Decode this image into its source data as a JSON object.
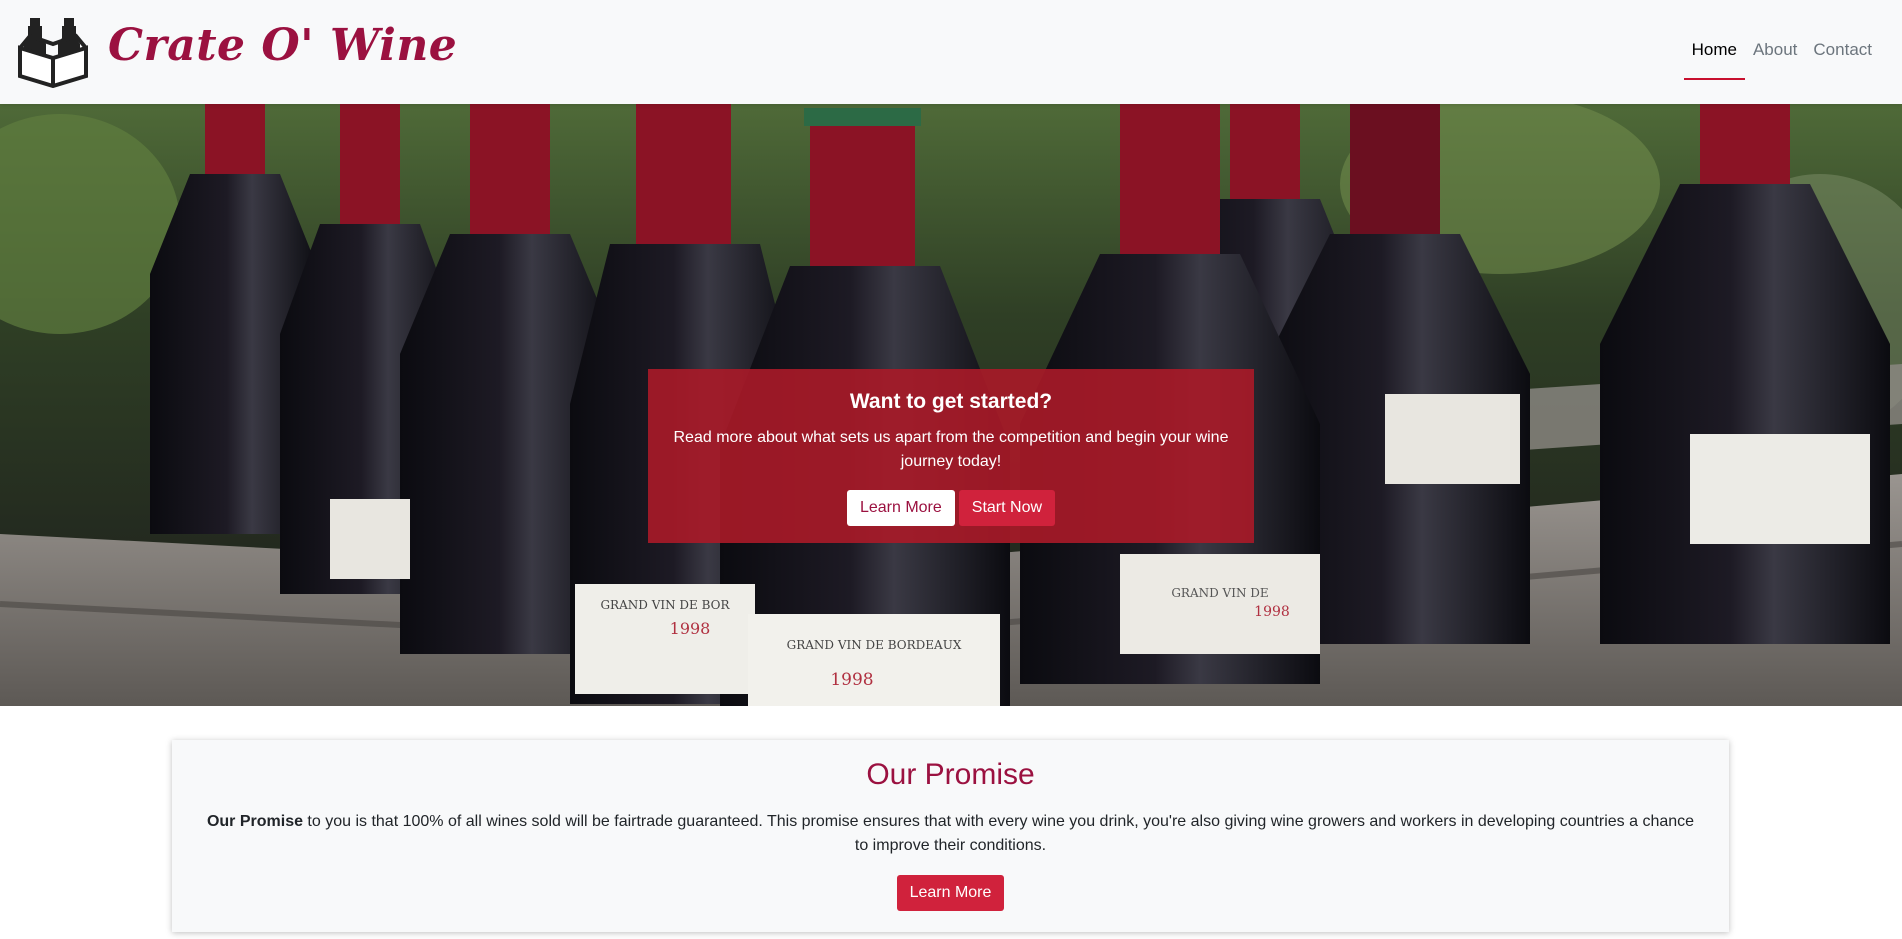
{
  "brand": {
    "name": "Crate O' Wine",
    "logo_icon": "wine-crate-icon",
    "color": "#9b1140"
  },
  "nav": {
    "items": [
      {
        "label": "Home",
        "active": true
      },
      {
        "label": "About",
        "active": false
      },
      {
        "label": "Contact",
        "active": false
      }
    ]
  },
  "hero": {
    "image": "wine-bottles-in-crate",
    "bottle_labels": [
      {
        "text": "GRAND VIN DE BORDEAUX",
        "year": "1998"
      },
      {
        "text": "GRAND VIN DE BOR",
        "year": "1998"
      },
      {
        "text": "GRAND VIN DE",
        "year": "1998"
      }
    ],
    "cta": {
      "heading": "Want to get started?",
      "body": "Read more about what sets us apart from the competition and begin your wine journey today!",
      "learn_more": "Learn More",
      "start_now": "Start Now"
    }
  },
  "promise": {
    "heading": "Our Promise",
    "lead_bold": "Our Promise",
    "text": " to you is that 100% of all wines sold will be fairtrade guaranteed. This promise ensures that with every wine you drink, you're also giving wine growers and workers in developing countries a chance to improve their conditions.",
    "button": "Learn More"
  },
  "colors": {
    "accent": "#d0223c",
    "cta_bg": "#aa1928",
    "nav_bg": "#f8f9fa"
  }
}
